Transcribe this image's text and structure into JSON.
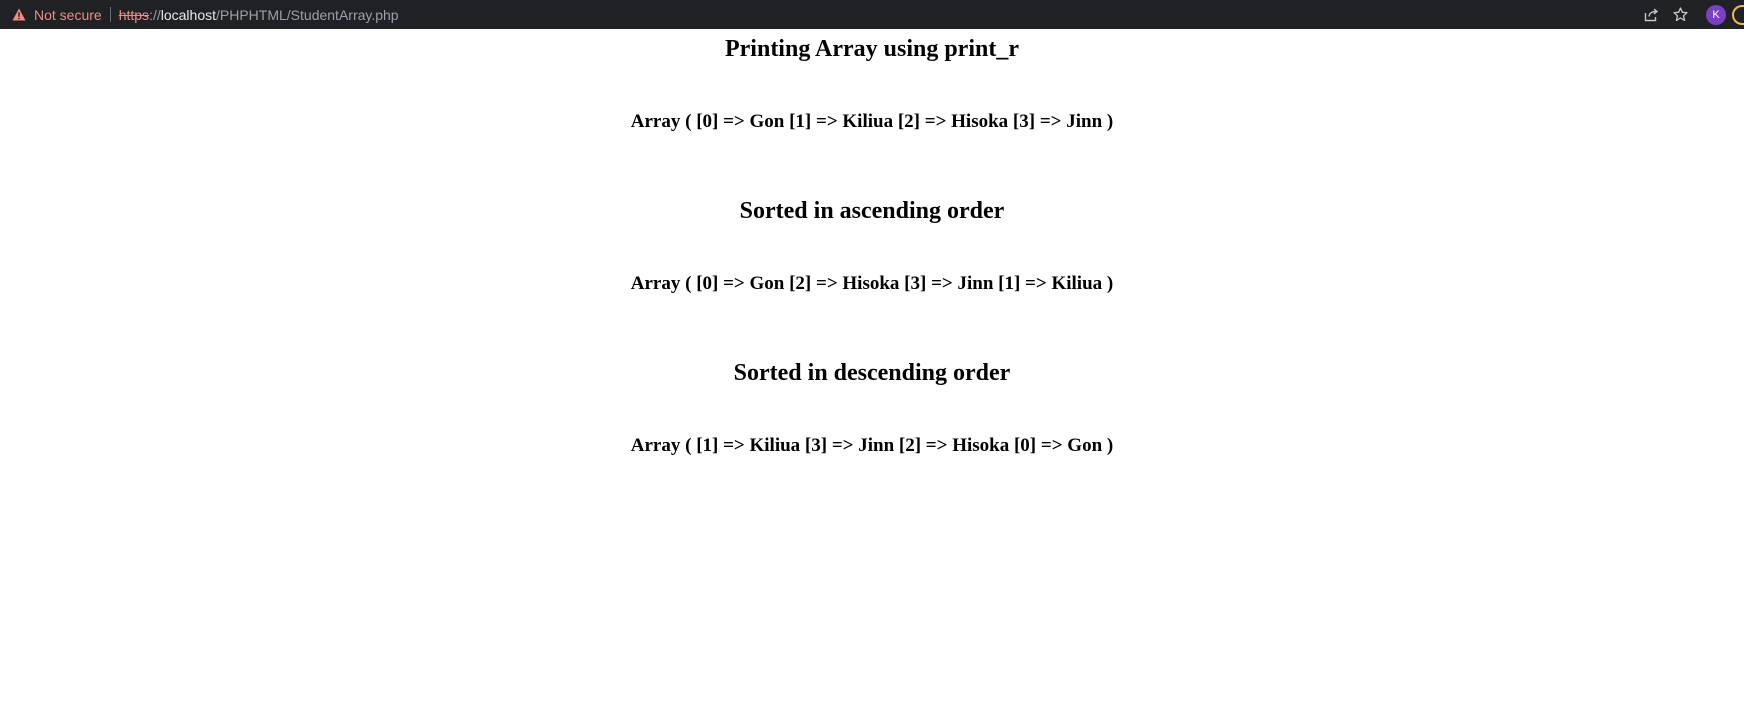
{
  "browser": {
    "security_label": "Not secure",
    "url": {
      "scheme": "https",
      "separator": "://",
      "host": "localhost",
      "path": "/PHPHTML/StudentArray.php"
    },
    "avatar_initial": "K",
    "colors": {
      "toolbar_bg": "#202124",
      "warning": "#f28b82",
      "avatar": "#7b3fc4"
    },
    "icons": [
      "warning-icon",
      "share-icon",
      "star-icon",
      "avatar",
      "extension-icon"
    ]
  },
  "page": {
    "sections": [
      {
        "heading": "Printing Array using print_r",
        "output": "Array ( [0] => Gon [1] => Kiliua [2] => Hisoka [3] => Jinn )"
      },
      {
        "heading": "Sorted in ascending order",
        "output": "Array ( [0] => Gon [2] => Hisoka [3] => Jinn [1] => Kiliua )"
      },
      {
        "heading": "Sorted in descending order",
        "output": "Array ( [1] => Kiliua [3] => Jinn [2] => Hisoka [0] => Gon )"
      }
    ]
  }
}
